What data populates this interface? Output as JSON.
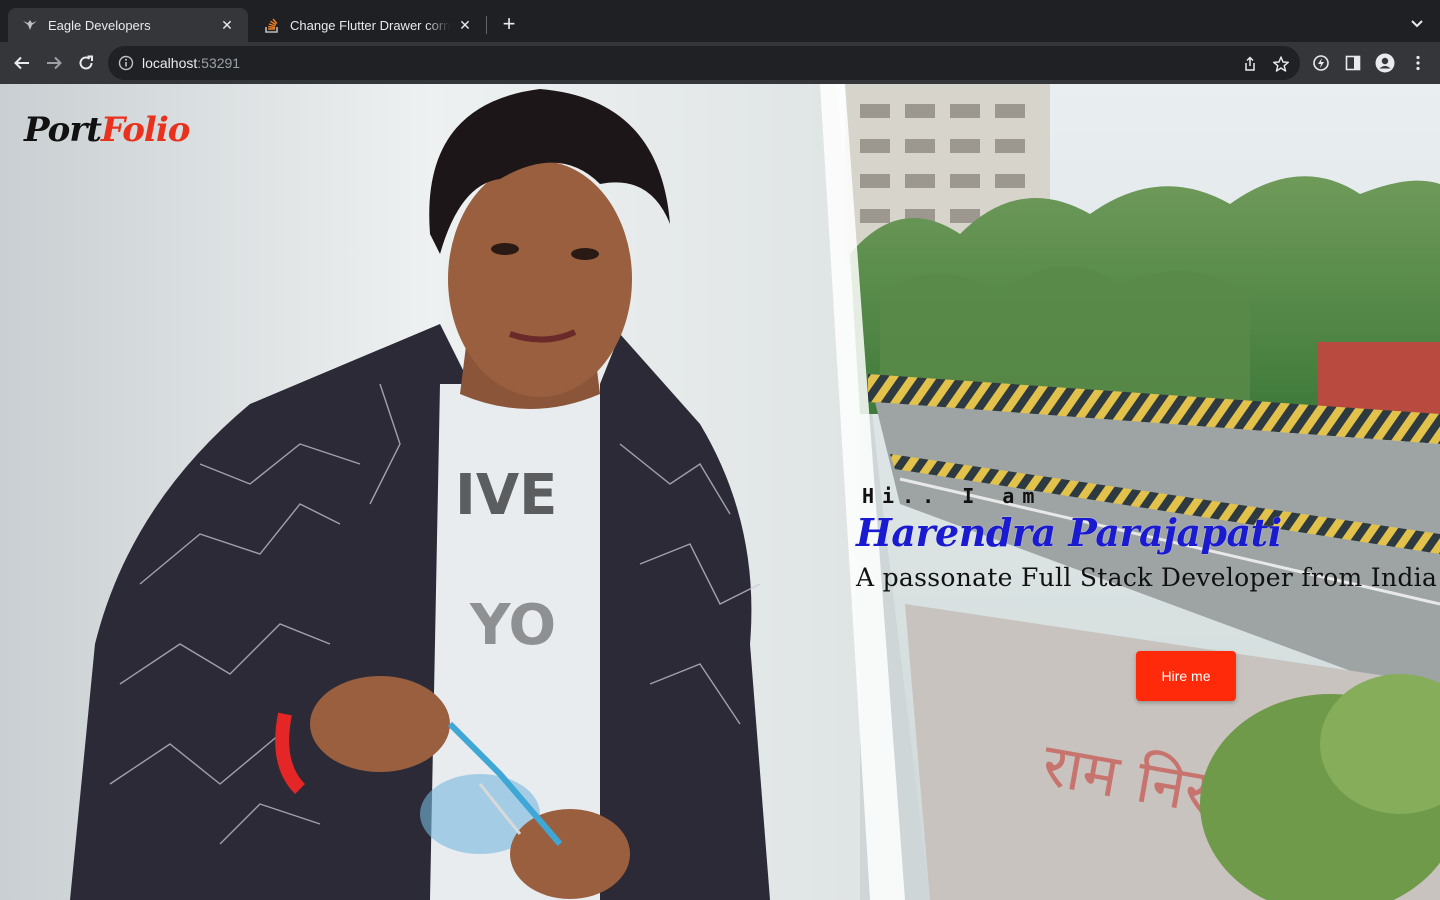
{
  "browser": {
    "tabs": [
      {
        "title": "Eagle Developers",
        "active": true,
        "favicon": "eagle-icon"
      },
      {
        "title": "Change Flutter Drawer corner",
        "active": false,
        "favicon": "stackoverflow-icon"
      }
    ],
    "url_host": "localhost",
    "url_port": ":53291"
  },
  "page": {
    "logo_part1": "Port",
    "logo_part2": "Folio",
    "greeting": "Hi.. I am",
    "name": "Harendra Parajapati",
    "tagline": "A passonate Full Stack Developer from India",
    "hire_label": "Hire me"
  },
  "colors": {
    "logo_accent": "#e8321e",
    "name": "#1a1ad0",
    "button": "#ff2a0a"
  }
}
